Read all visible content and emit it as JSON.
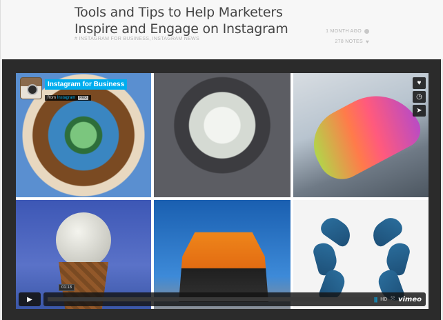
{
  "post": {
    "title": "Tools and Tips to Help Marketers Inspire and Engage on Instagram",
    "tags": "# INSTAGRAM FOR BUSINESS, INSTAGRAM NEWS",
    "time_ago": "1 MONTH AGO",
    "notes": "278 NOTES"
  },
  "video": {
    "channel_title": "Instagram for Business",
    "from_label": "from",
    "owner": "Instagram",
    "pro_badge": "PRO",
    "current_time": "01:13",
    "hd_label": "HD",
    "brand": "vimeo",
    "side_buttons": [
      {
        "icon": "heart-icon",
        "glyph": "♥"
      },
      {
        "icon": "clock-icon",
        "glyph": "◷"
      },
      {
        "icon": "send-icon",
        "glyph": "➤"
      }
    ],
    "play_glyph": "▶",
    "volume_glyph": "||||",
    "fullscreen_glyph": "⤧"
  },
  "colors": {
    "vimeo_accent": "#00adef",
    "frame_bg": "#2b2b2b"
  }
}
